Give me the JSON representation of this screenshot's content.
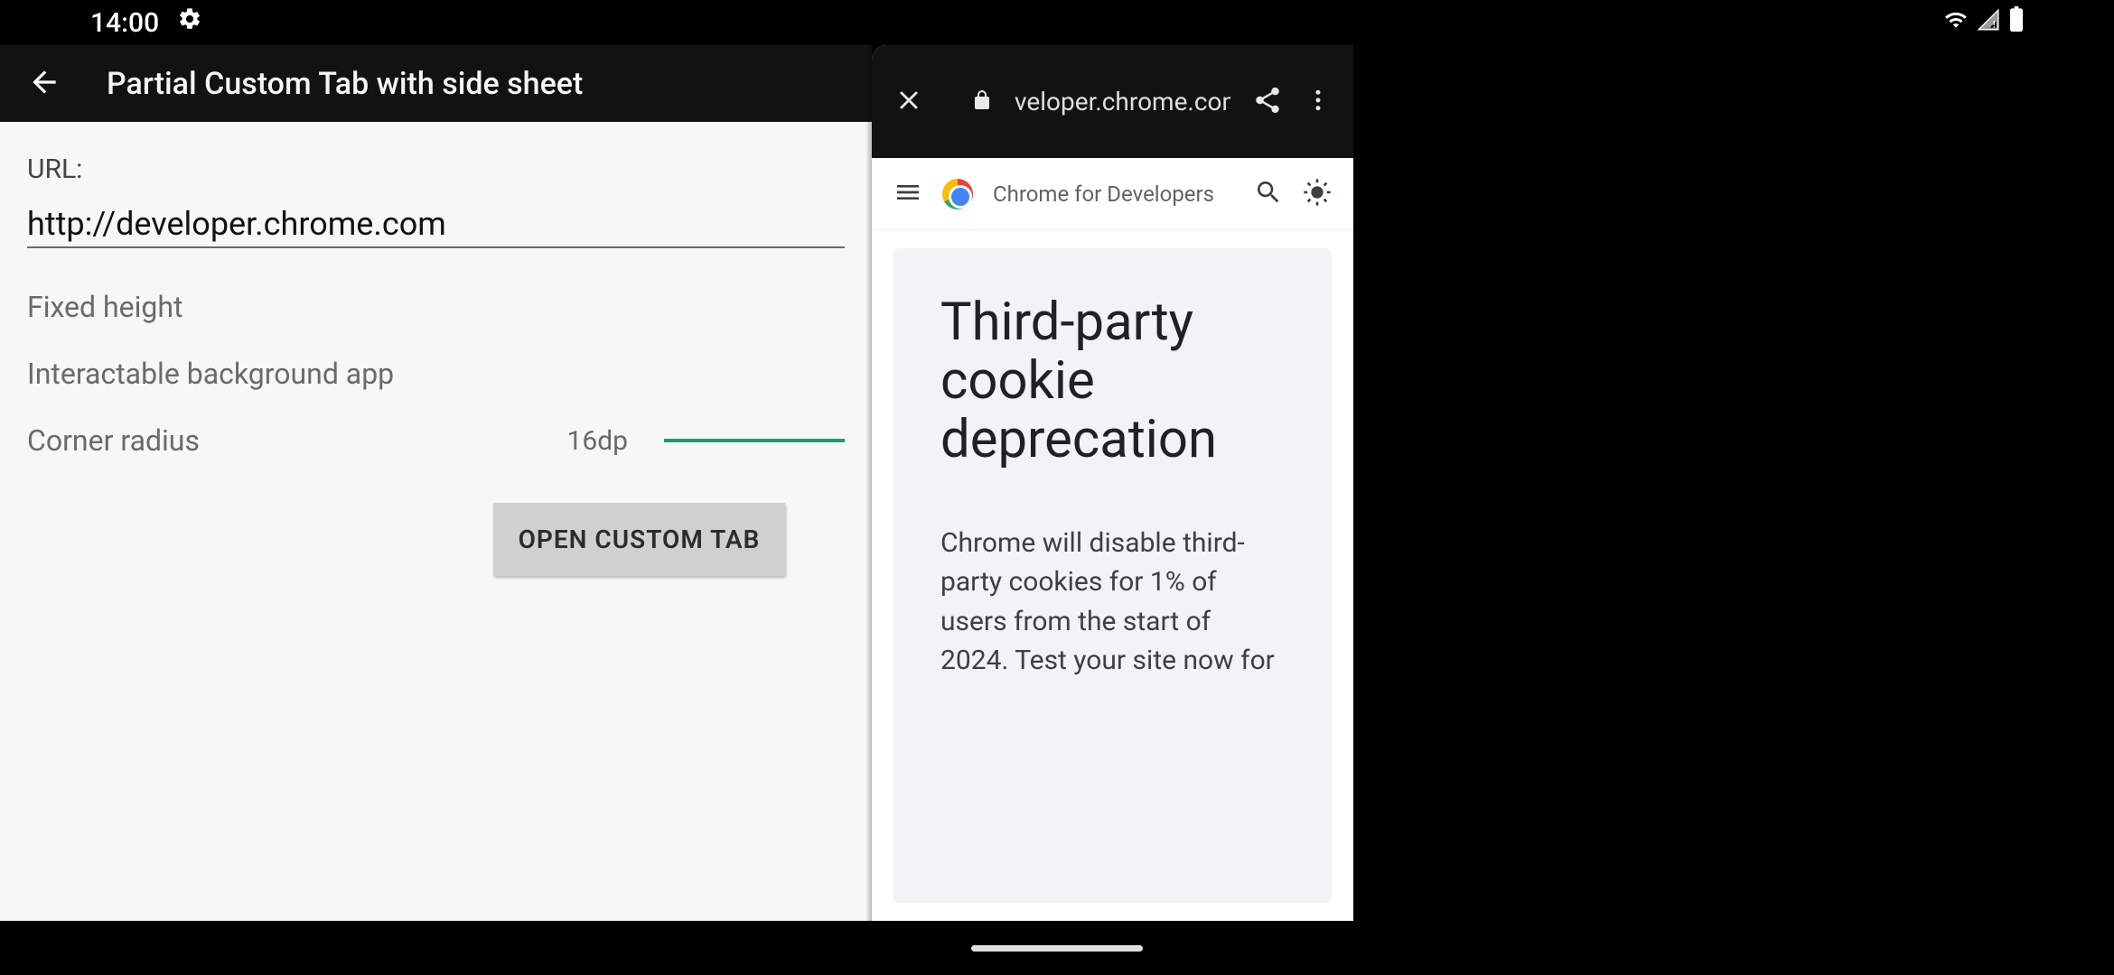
{
  "status_bar": {
    "time": "14:00"
  },
  "app": {
    "title": "Partial Custom Tab with side sheet",
    "url_label": "URL:",
    "url_value": "http://developer.chrome.com",
    "option_fixed_height": "Fixed height",
    "option_interactable_bg": "Interactable background app",
    "corner_radius_label": "Corner radius",
    "corner_radius_value": "16dp",
    "open_button": "OPEN CUSTOM TAB"
  },
  "side_sheet": {
    "url_display": "veloper.chrome.com",
    "site_name": "Chrome for Developers",
    "article_title": "Third-party cookie deprecation",
    "article_body": "Chrome will disable third-party cookies for 1% of users from the start of 2024. Test your site now for"
  }
}
